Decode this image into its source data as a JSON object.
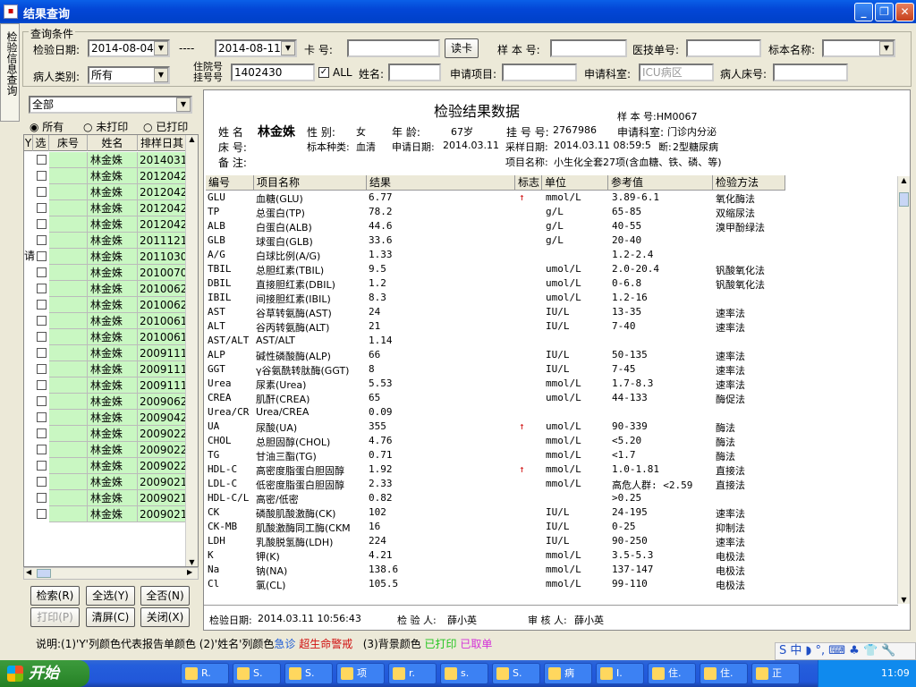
{
  "window": {
    "title": "结果查询"
  },
  "side_tab": "检验信息查询",
  "conditions": {
    "group_label": "查询条件",
    "date_label": "检验日期:",
    "date_from": "2014-08-04",
    "date_sep": "----",
    "date_to": "2014-08-11",
    "card_label": "卡  号:",
    "card_value": "",
    "read_card_button": "读卡",
    "sample_no_label": "样 本 号:",
    "sample_no_value": "",
    "medtech_label": "医技单号:",
    "medtech_value": "",
    "specimen_label": "标本名称:",
    "specimen_value": "",
    "patient_type_label": "病人类别:",
    "patient_type_value": "所有",
    "inpatient_label_1": "住院号",
    "inpatient_label_2": "挂号号",
    "inpatient_value": "1402430",
    "all_checkbox": "ALL",
    "name_label": "姓名:",
    "name_value": "",
    "apply_item_label": "申请项目:",
    "apply_item_value": "",
    "apply_dept_label": "申请科室:",
    "apply_dept_value": "ICU病区",
    "bed_label": "病人床号:",
    "bed_value": ""
  },
  "left": {
    "filter_value": "全部",
    "radio_all": "所有",
    "radio_unprinted": "未打印",
    "radio_printed": "已打印",
    "columns": [
      "Y",
      "选",
      "床号",
      "姓名",
      "排样日其"
    ],
    "side_char": "请",
    "rows": [
      {
        "name": "林金姝",
        "date": "2014031"
      },
      {
        "name": "林金姝",
        "date": "2012042"
      },
      {
        "name": "林金姝",
        "date": "2012042"
      },
      {
        "name": "林金姝",
        "date": "2012042"
      },
      {
        "name": "林金姝",
        "date": "2012042"
      },
      {
        "name": "林金姝",
        "date": "2011121"
      },
      {
        "name": "林金姝",
        "date": "2011030"
      },
      {
        "name": "林金姝",
        "date": "2010070"
      },
      {
        "name": "林金姝",
        "date": "2010062"
      },
      {
        "name": "林金姝",
        "date": "2010062"
      },
      {
        "name": "林金姝",
        "date": "2010061"
      },
      {
        "name": "林金姝",
        "date": "2010061"
      },
      {
        "name": "林金姝",
        "date": "2009111"
      },
      {
        "name": "林金姝",
        "date": "2009111"
      },
      {
        "name": "林金姝",
        "date": "2009111"
      },
      {
        "name": "林金姝",
        "date": "2009062"
      },
      {
        "name": "林金姝",
        "date": "2009042"
      },
      {
        "name": "林金姝",
        "date": "2009022"
      },
      {
        "name": "林金姝",
        "date": "2009022"
      },
      {
        "name": "林金姝",
        "date": "2009022"
      },
      {
        "name": "林金姝",
        "date": "2009021"
      },
      {
        "name": "林金姝",
        "date": "2009021"
      },
      {
        "name": "林金姝",
        "date": "2009021"
      }
    ],
    "buttons": {
      "search": "检索(R)",
      "select_all": "全选(Y)",
      "select_none": "全否(N)",
      "print": "打印(P)",
      "clear": "清屏(C)",
      "close": "关闭(X)"
    }
  },
  "report": {
    "title": "检验结果数据",
    "sample_no": "样 本 号:HM0067",
    "name_label": "姓    名",
    "name": "林金姝",
    "sex_label": "性    别:",
    "sex": "女",
    "age_label": "年    龄:",
    "age": "67岁",
    "reg_label": "挂 号 号:",
    "reg_no": "2767986",
    "dept_label": "申请科室:",
    "dept": "门诊内分泌",
    "bed_label": "床    号:",
    "specimen_label": "标本种类:",
    "specimen": "血清",
    "apply_date_label": "申请日期:",
    "apply_date": "2014.03.11",
    "collect_label": "采样日期:",
    "collect_date": "2014.03.11 08:59:5",
    "diagnosis_label": "断:",
    "diagnosis": "2型糖尿病",
    "remark_label": "备    注:",
    "item_label": "项目名称:",
    "item_name": "小生化全套27项(含血糖、铁、磷、等)",
    "columns": [
      "编号",
      "项目名称",
      "结果",
      "标志",
      "单位",
      "参考值",
      "检验方法"
    ],
    "rows": [
      {
        "code": "GLU",
        "name": "血糖(GLU)",
        "result": "6.77",
        "flag": "↑",
        "unit": "mmol/L",
        "ref": "3.89-6.1",
        "method": "氧化酶法"
      },
      {
        "code": "TP",
        "name": "总蛋白(TP)",
        "result": "78.2",
        "flag": "",
        "unit": "g/L",
        "ref": "65-85",
        "method": "双缩尿法"
      },
      {
        "code": "ALB",
        "name": "白蛋白(ALB)",
        "result": "44.6",
        "flag": "",
        "unit": "g/L",
        "ref": "40-55",
        "method": "溴甲酚绿法"
      },
      {
        "code": "GLB",
        "name": "球蛋白(GLB)",
        "result": "33.6",
        "flag": "",
        "unit": "g/L",
        "ref": "20-40",
        "method": ""
      },
      {
        "code": "A/G",
        "name": "白球比例(A/G)",
        "result": "1.33",
        "flag": "",
        "unit": "",
        "ref": "1.2-2.4",
        "method": ""
      },
      {
        "code": "TBIL",
        "name": "总胆红素(TBIL)",
        "result": "9.5",
        "flag": "",
        "unit": "umol/L",
        "ref": "2.0-20.4",
        "method": "钒酸氧化法"
      },
      {
        "code": "DBIL",
        "name": "直接胆红素(DBIL)",
        "result": "1.2",
        "flag": "",
        "unit": "umol/L",
        "ref": "0-6.8",
        "method": "钒酸氧化法"
      },
      {
        "code": "IBIL",
        "name": "间接胆红素(IBIL)",
        "result": "8.3",
        "flag": "",
        "unit": "umol/L",
        "ref": "1.2-16",
        "method": ""
      },
      {
        "code": "AST",
        "name": "谷草转氨酶(AST)",
        "result": "24",
        "flag": "",
        "unit": "IU/L",
        "ref": "13-35",
        "method": "速率法"
      },
      {
        "code": "ALT",
        "name": "谷丙转氨酶(ALT)",
        "result": "21",
        "flag": "",
        "unit": "IU/L",
        "ref": "7-40",
        "method": "速率法"
      },
      {
        "code": "AST/ALT",
        "name": "AST/ALT",
        "result": "1.14",
        "flag": "",
        "unit": "",
        "ref": "",
        "method": ""
      },
      {
        "code": "ALP",
        "name": "碱性磷酸酶(ALP)",
        "result": "66",
        "flag": "",
        "unit": "IU/L",
        "ref": "50-135",
        "method": "速率法"
      },
      {
        "code": "GGT",
        "name": "γ谷氨酰转肽酶(GGT)",
        "result": "8",
        "flag": "",
        "unit": "IU/L",
        "ref": "7-45",
        "method": "速率法"
      },
      {
        "code": "Urea",
        "name": "尿素(Urea)",
        "result": "5.53",
        "flag": "",
        "unit": "mmol/L",
        "ref": "1.7-8.3",
        "method": "速率法"
      },
      {
        "code": "CREA",
        "name": "肌酐(CREA)",
        "result": "65",
        "flag": "",
        "unit": "umol/L",
        "ref": "44-133",
        "method": "酶促法"
      },
      {
        "code": "Urea/CR",
        "name": "Urea/CREA",
        "result": "0.09",
        "flag": "",
        "unit": "",
        "ref": "",
        "method": ""
      },
      {
        "code": "UA",
        "name": "尿酸(UA)",
        "result": "355",
        "flag": "↑",
        "unit": "umol/L",
        "ref": "90-339",
        "method": "酶法"
      },
      {
        "code": "CHOL",
        "name": "总胆固醇(CHOL)",
        "result": "4.76",
        "flag": "",
        "unit": "mmol/L",
        "ref": "<5.20",
        "method": "酶法"
      },
      {
        "code": "TG",
        "name": "甘油三酯(TG)",
        "result": "0.71",
        "flag": "",
        "unit": "mmol/L",
        "ref": "<1.7",
        "method": "酶法"
      },
      {
        "code": "HDL-C",
        "name": "高密度脂蛋白胆固醇",
        "result": "1.92",
        "flag": "↑",
        "unit": "mmol/L",
        "ref": "1.0-1.81",
        "method": "直接法"
      },
      {
        "code": "LDL-C",
        "name": "低密度脂蛋白胆固醇",
        "result": "2.33",
        "flag": "",
        "unit": "mmol/L",
        "ref": "高危人群: <2.59",
        "method": "直接法"
      },
      {
        "code": "HDL-C/L",
        "name": "高密/低密",
        "result": "0.82",
        "flag": "",
        "unit": "",
        "ref": ">0.25",
        "method": ""
      },
      {
        "code": "CK",
        "name": "磷酸肌酸激酶(CK)",
        "result": "102",
        "flag": "",
        "unit": "IU/L",
        "ref": "24-195",
        "method": "速率法"
      },
      {
        "code": "CK-MB",
        "name": "肌酸激酶同工酶(CKM",
        "result": "16",
        "flag": "",
        "unit": "IU/L",
        "ref": "0-25",
        "method": "抑制法"
      },
      {
        "code": "LDH",
        "name": "乳酸脱氢酶(LDH)",
        "result": "224",
        "flag": "",
        "unit": "IU/L",
        "ref": "90-250",
        "method": "速率法"
      },
      {
        "code": "K",
        "name": "钾(K)",
        "result": "4.21",
        "flag": "",
        "unit": "mmol/L",
        "ref": "3.5-5.3",
        "method": "电极法"
      },
      {
        "code": "Na",
        "name": "钠(NA)",
        "result": "138.6",
        "flag": "",
        "unit": "mmol/L",
        "ref": "137-147",
        "method": "电极法"
      },
      {
        "code": "Cl",
        "name": "氯(CL)",
        "result": "105.5",
        "flag": "",
        "unit": "mmol/L",
        "ref": "99-110",
        "method": "电极法"
      }
    ],
    "footer_date_label": "检验日期:",
    "footer_date": "2014.03.11 10:56:43",
    "tester_label": "检 验 人:",
    "tester": "薛小英",
    "reviewer_label": "审 核 人:",
    "reviewer": "薛小英"
  },
  "legend": {
    "prefix": "说明:(1)'Y'列颜色代表报告单颜色  (2)'姓名'列颜色",
    "urgent": "急诊",
    "critical": "超生命警戒",
    "bg": "(3)背景颜色",
    "printed": "已打印",
    "voided": "已取单"
  },
  "taskbar": {
    "start": "开始",
    "tasks": [
      "R.",
      "S.",
      "S.",
      "项",
      "r.",
      "s.",
      "S.",
      "病",
      "I.",
      "住.",
      "住.",
      "正"
    ],
    "clock": "11:09"
  },
  "colors": {
    "urgent": "#1C5BD6",
    "critical": "#D01010",
    "printed": "#22C51E",
    "voided": "#D432D8",
    "row_bg": "#C9F7C2"
  }
}
